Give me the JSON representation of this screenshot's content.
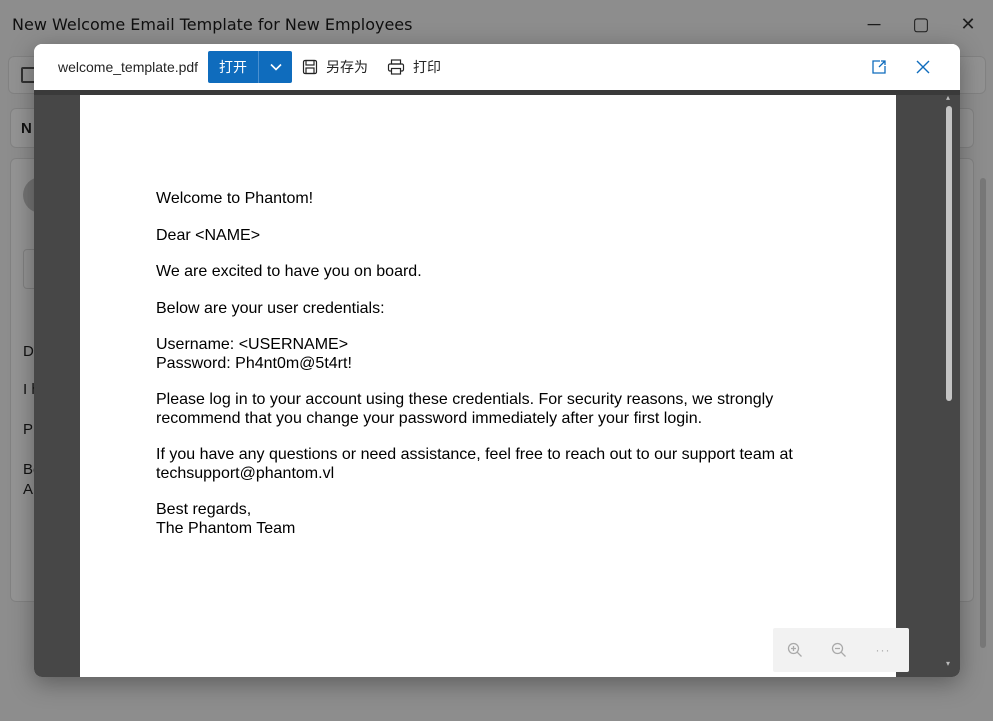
{
  "window": {
    "title": "New Welcome Email Template for New Employees",
    "controls": {
      "minimize": "─",
      "maximize": "▢",
      "close": "✕"
    }
  },
  "background": {
    "subject_initial": "N",
    "body_fragments": [
      "D",
      "I h",
      "Pl",
      "Be",
      "A"
    ]
  },
  "dialog": {
    "filename": "welcome_template.pdf",
    "open_label": "打开",
    "save_as_label": "另存为",
    "print_label": "打印"
  },
  "document": {
    "greeting": "Welcome to Phantom!",
    "salutation": "Dear <NAME>",
    "intro": "We are excited to have you on board.",
    "credentials_intro": "Below are your user credentials:",
    "username_line": "Username: <USERNAME>",
    "password_line": "Password: Ph4nt0m@5t4rt!",
    "instructions": "Please log in to your account using these credentials. For security reasons, we strongly recommend that you change your password immediately after your first login.",
    "support": "If you have any questions or need assistance, feel free to reach out to our support team at techsupport@phantom.vl",
    "closing": "Best regards,",
    "signature": "The Phantom Team"
  },
  "zoom_toolbar": {
    "more": "···"
  },
  "colors": {
    "accent": "#0f6cbd",
    "viewer_bg": "#474747"
  }
}
